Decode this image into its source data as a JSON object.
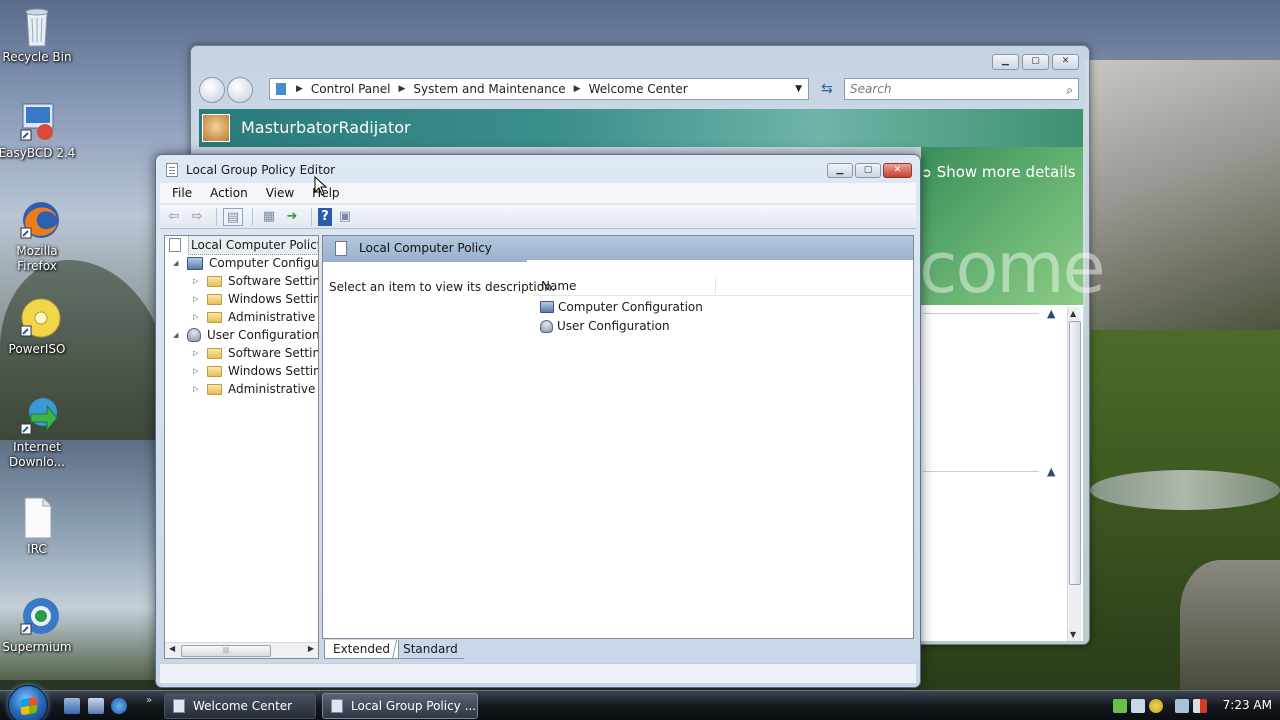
{
  "desktop": {
    "icons": [
      {
        "label": "Recycle Bin",
        "icon": "recycle-bin-icon"
      },
      {
        "label": "EasyBCD 2.4",
        "icon": "easybcd-icon"
      },
      {
        "label": "Mozilla Firefox",
        "icon": "firefox-icon"
      },
      {
        "label": "PowerISO",
        "icon": "poweriso-icon"
      },
      {
        "label": "Internet Downlo...",
        "icon": "internet-download-manager-icon"
      },
      {
        "label": "IRC",
        "icon": "text-file-icon"
      },
      {
        "label": "Supermium",
        "icon": "supermium-icon"
      }
    ]
  },
  "welcome_center": {
    "address": {
      "crumbs": [
        "Control Panel",
        "System and Maintenance",
        "Welcome Center"
      ]
    },
    "search_placeholder": "Search",
    "user_name": "MasturbatorRadijator",
    "show_more": "Show more details",
    "welcome_text": "come"
  },
  "gpe": {
    "title": "Local Group Policy Editor",
    "menu": [
      "File",
      "Action",
      "View",
      "Help"
    ],
    "tree": {
      "root": "Local Computer Policy",
      "computer": "Computer Configura",
      "computer_children": [
        "Software Settings",
        "Windows Setting",
        "Administrative Te"
      ],
      "user": "User Configuration",
      "user_children": [
        "Software Settings",
        "Windows Setting",
        "Administrative Te"
      ]
    },
    "details_header": "Local Computer Policy",
    "description": "Select an item to view its description.",
    "column_name": "Name",
    "items": [
      "Computer Configuration",
      "User Configuration"
    ],
    "tabs": [
      "Extended",
      "Standard"
    ]
  },
  "taskbar": {
    "buttons": [
      "Welcome Center",
      "Local Group Policy ..."
    ],
    "clock": "7:23 AM"
  }
}
